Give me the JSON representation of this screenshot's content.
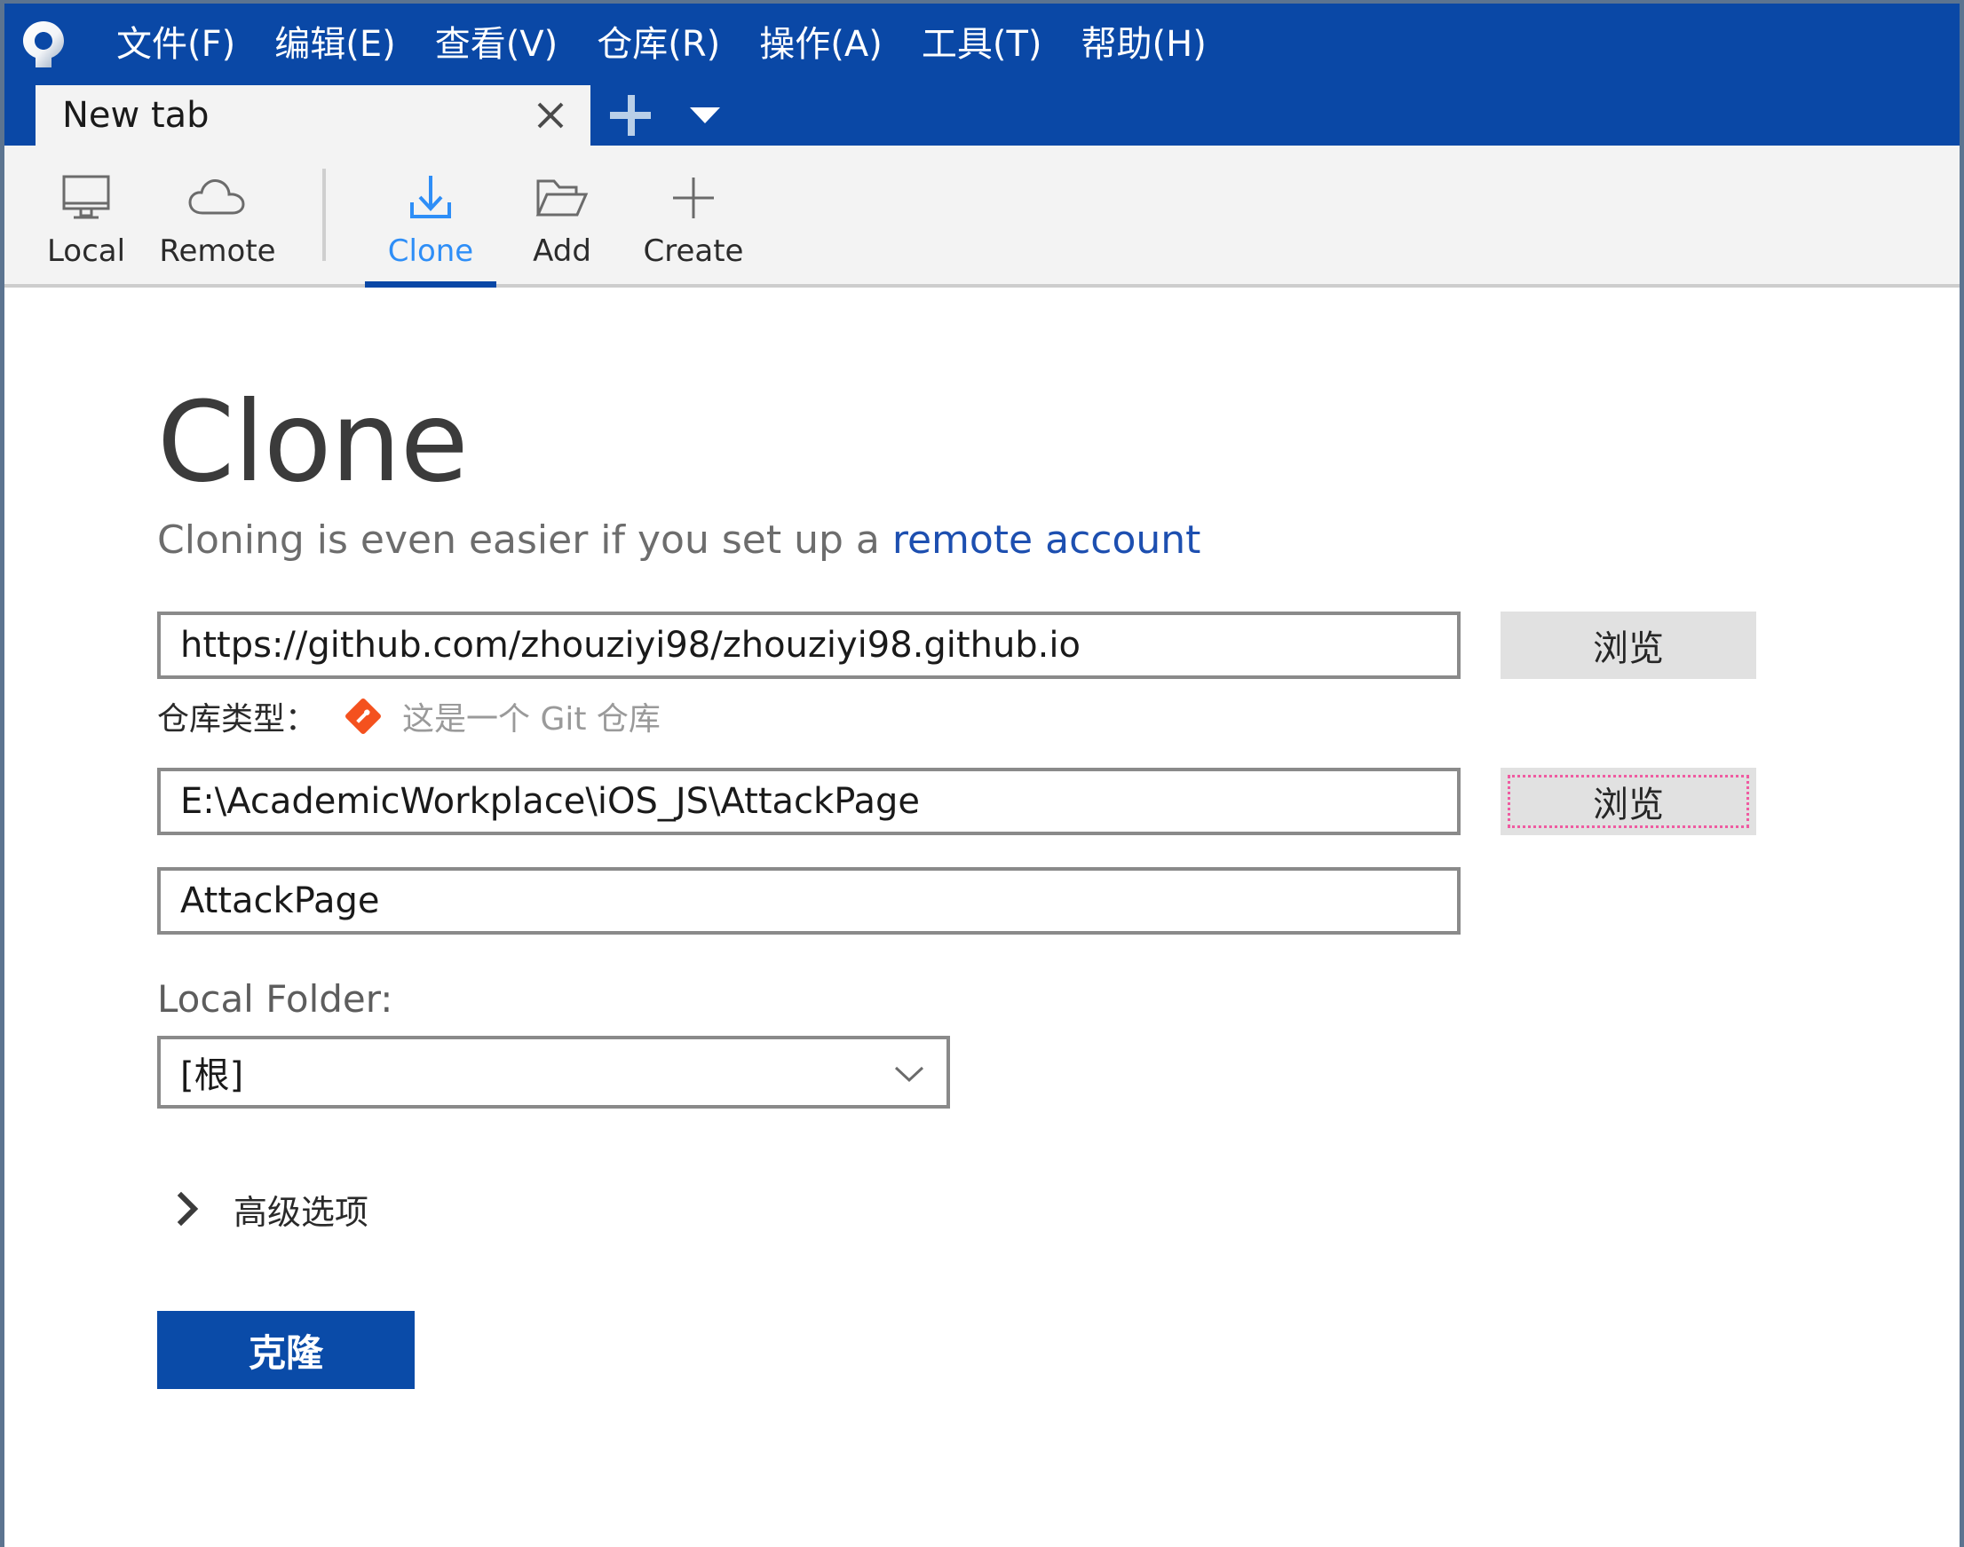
{
  "window": {
    "app_name": "SourceTree",
    "logo_icon": "sourcetree-logo-icon"
  },
  "menubar": {
    "items": [
      {
        "label": "文件(F)",
        "text": "文件(",
        "accel": "F",
        "tail": ")"
      },
      {
        "label": "编辑(E)",
        "text": "编辑(",
        "accel": "E",
        "tail": ")"
      },
      {
        "label": "查看(V)",
        "text": "查看(",
        "accel": "V",
        "tail": ")"
      },
      {
        "label": "仓库(R)",
        "text": "仓库(",
        "accel": "R",
        "tail": ")"
      },
      {
        "label": "操作(A)",
        "text": "操作(",
        "accel": "A",
        "tail": ")"
      },
      {
        "label": "工具(T)",
        "text": "工具(",
        "accel": "T",
        "tail": ")"
      },
      {
        "label": "帮助(H)",
        "text": "帮助(",
        "accel": "H",
        "tail": ")"
      }
    ]
  },
  "tabstrip": {
    "tabs": [
      {
        "title": "New tab",
        "active": true,
        "close_icon": "close-icon"
      }
    ],
    "new_tab_icon": "plus-icon",
    "tab_list_dropdown_icon": "chevron-down-icon"
  },
  "toolbar": {
    "buttons": [
      {
        "label": "Local",
        "icon": "monitor-icon",
        "active": false
      },
      {
        "label": "Remote",
        "icon": "cloud-icon",
        "active": false
      },
      {
        "label": "Clone",
        "icon": "download-icon",
        "active": true
      },
      {
        "label": "Add",
        "icon": "open-folder-icon",
        "active": false
      },
      {
        "label": "Create",
        "icon": "plus-icon",
        "active": false
      }
    ]
  },
  "main": {
    "title": "Clone",
    "subtitle_prefix": "Cloning is even easier if you set up a ",
    "subtitle_link": "remote account",
    "source_url": {
      "value": "https://github.com/zhouziyi98/zhouziyi98.github.io",
      "browse_label": "浏览"
    },
    "repo_type": {
      "label": "仓库类型：",
      "icon": "git-diamond-icon",
      "value": "这是一个 Git 仓库"
    },
    "destination_path": {
      "value": "E:\\AcademicWorkplace\\iOS_JS\\AttackPage",
      "browse_label": "浏览",
      "browse_focused": true
    },
    "name": {
      "value": "AttackPage"
    },
    "local_folder": {
      "label": "Local Folder:",
      "value": "[根]",
      "chevron_icon": "chevron-down-icon"
    },
    "advanced": {
      "label": "高级选项",
      "chevron_icon": "chevron-right-icon",
      "expanded": false
    },
    "submit": {
      "label": "克隆"
    }
  },
  "colors": {
    "brand_blue": "#0a48a6",
    "accent_blue": "#2e8ef7",
    "link_blue": "#1d4fb0",
    "toolbar_bg": "#f3f3f3",
    "field_border": "#8a8a8a",
    "focus_pink": "#ef5ba1",
    "git_orange": "#f4511e"
  }
}
